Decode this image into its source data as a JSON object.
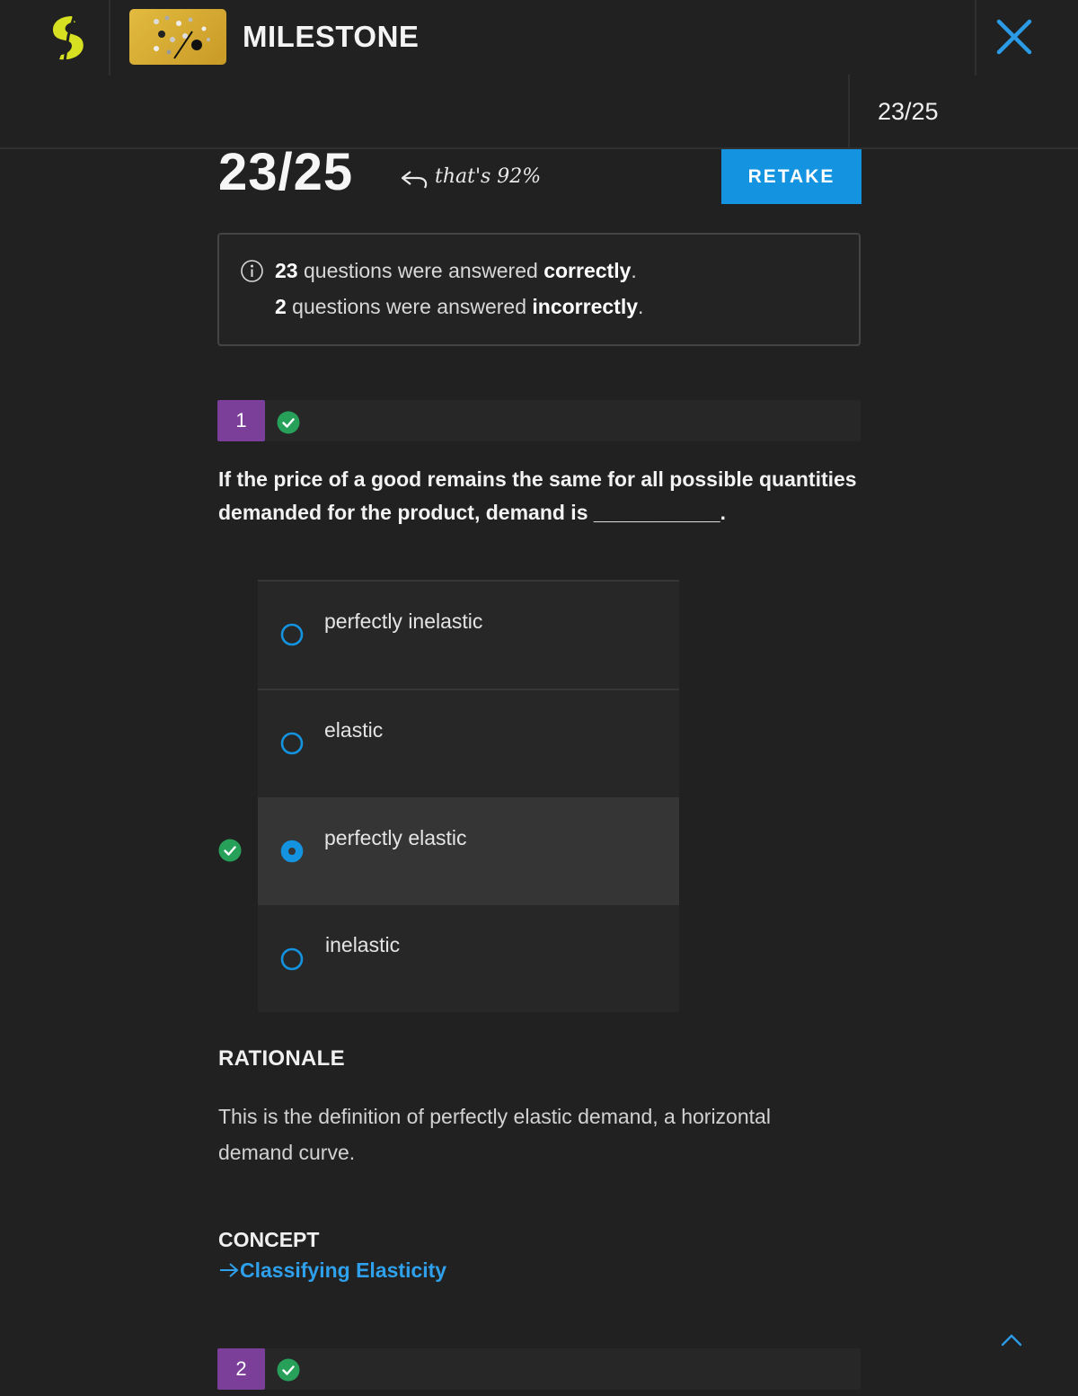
{
  "header": {
    "title": "MILESTONE",
    "progress_count": "23/25"
  },
  "score": {
    "value": "23/25",
    "percent_note": "that's 92%",
    "retake_label": "RETAKE"
  },
  "summary": {
    "correct_count": "23",
    "correct_text_a": " questions were answered ",
    "correct_word": "correctly",
    "incorrect_count": "2",
    "incorrect_text_a": " questions were answered ",
    "incorrect_word": "incorrectly",
    "period": "."
  },
  "questions": [
    {
      "number": "1",
      "status": "correct",
      "text": "If the price of a good remains the same for all possible quantities demanded for the product, demand is ___________.",
      "options": [
        {
          "label": "perfectly inelastic",
          "selected": false
        },
        {
          "label": "elastic",
          "selected": false
        },
        {
          "label": "perfectly elastic",
          "selected": true,
          "correct": true
        },
        {
          "label": "inelastic",
          "selected": false
        }
      ],
      "rationale_heading": "RATIONALE",
      "rationale": "This is the definition of perfectly elastic demand, a horizontal demand curve.",
      "concept_heading": "CONCEPT",
      "concept_link": "Classifying Elasticity"
    },
    {
      "number": "2",
      "status": "correct"
    }
  ],
  "colors": {
    "background": "#212121",
    "accent_blue": "#1493e0",
    "link_blue": "#2ea0ec",
    "purple_badge": "#7b3f9a",
    "correct_green": "#27a05a",
    "logo_yellow": "#d7e021"
  },
  "icons": {
    "logo": "sophia-logo-icon",
    "close": "close-icon",
    "info": "info-icon",
    "check": "check-circle-icon",
    "scroll_up": "chevron-up-icon",
    "back_arrow": "curved-arrow-icon",
    "link_arrow": "arrow-right-icon"
  }
}
